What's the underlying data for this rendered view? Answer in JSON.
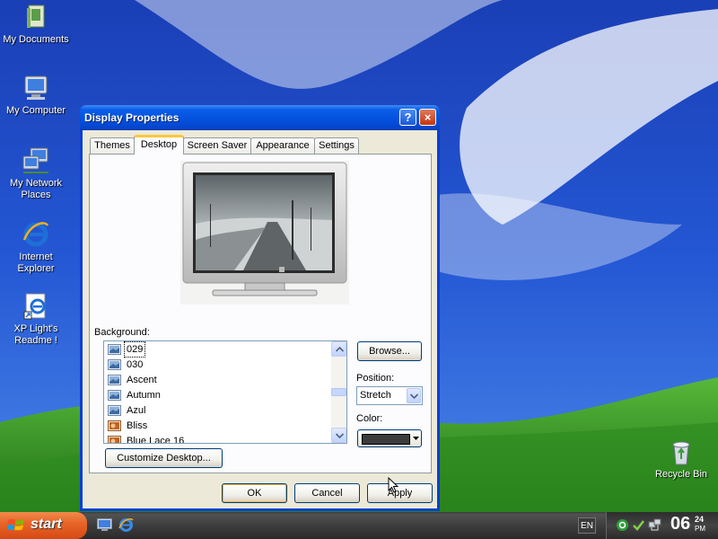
{
  "desktop": {
    "icons": [
      {
        "label": "My Documents",
        "icon": "my-documents-icon"
      },
      {
        "label": "My Computer",
        "icon": "my-computer-icon"
      },
      {
        "label": "My Network Places",
        "icon": "network-places-icon"
      },
      {
        "label": "Internet Explorer",
        "icon": "internet-explorer-icon"
      },
      {
        "label": "XP Light's Readme !",
        "icon": "readme-icon"
      },
      {
        "label": "Recycle Bin",
        "icon": "recycle-bin-icon"
      }
    ]
  },
  "dialog": {
    "title": "Display Properties",
    "help_button": "?",
    "close_button": "×",
    "tabs": [
      {
        "label": "Themes",
        "active": false
      },
      {
        "label": "Desktop",
        "active": true
      },
      {
        "label": "Screen Saver",
        "active": false
      },
      {
        "label": "Appearance",
        "active": false
      },
      {
        "label": "Settings",
        "active": false
      }
    ],
    "background_label": "Background:",
    "backgrounds": [
      {
        "name": "029",
        "icon": "wallpaper-icon",
        "selected": true
      },
      {
        "name": "030",
        "icon": "wallpaper-icon",
        "selected": false
      },
      {
        "name": "Ascent",
        "icon": "wallpaper-icon",
        "selected": false
      },
      {
        "name": "Autumn",
        "icon": "wallpaper-icon",
        "selected": false
      },
      {
        "name": "Azul",
        "icon": "wallpaper-icon",
        "selected": false
      },
      {
        "name": "Bliss",
        "icon": "bitmap-icon",
        "selected": false
      },
      {
        "name": "Blue Lace 16",
        "icon": "bitmap-icon",
        "selected": false
      }
    ],
    "browse_button": "Browse...",
    "position_label": "Position:",
    "position_value": "Stretch",
    "color_label": "Color:",
    "color_value": "#3c3c3c",
    "customize_button": "Customize Desktop...",
    "ok_button": "OK",
    "cancel_button": "Cancel",
    "apply_button": "Apply"
  },
  "taskbar": {
    "start_label": "start",
    "language": "EN",
    "clock_hour": "06",
    "clock_minute": "24",
    "clock_period": "PM"
  },
  "colors": {
    "titlebar": "#0553e0",
    "dialog_face": "#ece9d8",
    "start_button": "#e8652a",
    "taskbar": "#3d3d3d"
  }
}
